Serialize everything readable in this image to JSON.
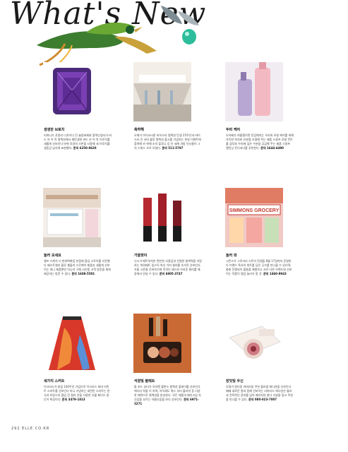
{
  "page_title": "What's New",
  "folio": "292 ELLE.CO.KR",
  "items": [
    {
      "title": "생생한 브로치",
      "body": "티파니가 푸알리 디자이너 진 슐럼버제와 협력인생사가 버드 온 어 락 컬렉션에서 재탄생한 버드 온 어 락 브로치를 새롭게 선보인다 바위 모양의 스톤을 사용해 새 브로치를 생동감 넘치게 표현했다.",
      "contact": "문의 6250-8620"
    },
    {
      "title": "축하해",
      "body": "오에가 아이코닉한 바이스타 컬렉션 탄생 25주년과 바이스타 인 서머 블루 컬렉션 출시를 기념하는 론칭 이벤트에 참여해 카 위해 조치 플루니 등 인 세계 과방 인사들이 그의 스위스 조로 모였다.",
      "contact": "문의 511-5797"
    },
    {
      "title": "두피 케어",
      "body": "오아베가 여름철이면 민감해지는 두피와 모발 케어를 위해 가득한 피지와 유분을 조절해 주는 제품 스칼프 모발 컨트롤 샴푸와 두피에 깊은 수분을 공급해 주는 제품 스칼프 엘린닝 컨디셔너를 추천한다.",
      "contact": "문의 1644-4490"
    },
    {
      "title": "놀러 오세요",
      "body": "셀프 스케치 더 현대백화점 본점에 팝업 스토어를 오픈했다 베스트셀러 블루 셸플러 스킨케어 제품과 새롭게 선보이는 피니 제품뿐만 아니라 구매 사은품 고객 방문을 회에 제공하는 방문 수 있다.",
      "contact": "문의 1688-5501"
    },
    {
      "title": "가을맞이",
      "body": "나스가 매트하지만 편안한 사용감과 선명한 발색력을 자랑하는 파워매트 립스틱 여섯 가지 컬러를 추가로 선보인다. 가을 시즌을 준비하기에 적격인 레드와 브라운 컬러를 매장에서 만날 수 있다.",
      "contact": "문의 6905-3747"
    },
    {
      "title": "놀러 와",
      "body": "시몬스가 그로서리 스토어 컨셉을 8월 17일까지 운영한다 브랜드 특유의 위트를 담은 굿즈를 만나볼 수 있으며, 층층 진열되어 볼들을 체험하고 서로 다른 브랜드와 선보이는 작품이 협업 놀러가 알 것.",
      "contact": "문의 1460-8943"
    },
    {
      "title": "세가지 스커트",
      "body": "이크라스가 창립 100주년 기념으로 이크라스 세비 리빈트 스커트를 선보인다 미니 기념하는 세련된 스커트는 한국과 프랑스의 협업 전 컬러 언을 사용한 더블 페이스 원단이 특징이다.",
      "contact": "문의 3479-1813"
    },
    {
      "title": "석양빛 팔레트",
      "body": "톰 포드 뷰티가 유러렌 블론드 컬렉션 플레이를 선보인다 에디터 픽을 이 하며, 아이섀도 쿼드 부터 블러쉬 등 다양한 매력으로 컬렉션을 완성한다. 모든 제품의 메이크업 자신감을 부르는 아름다움을 보다 선보인다.",
      "contact": "문의 6971-3271"
    },
    {
      "title": "장밋빛 우신",
      "body": "오휘가 얼티밋 커버리칭 쿠션 블라썸 에디션을 선보인다 떼떼 새로운 향과 함께 선보이는 리미티드 에디션은 블러셔 전략적인 장미를 담아 패키지의 밝다 기분을 핑크 쿠션을 만나볼 수 있다.",
      "contact": "문의 080-023-7007"
    }
  ]
}
